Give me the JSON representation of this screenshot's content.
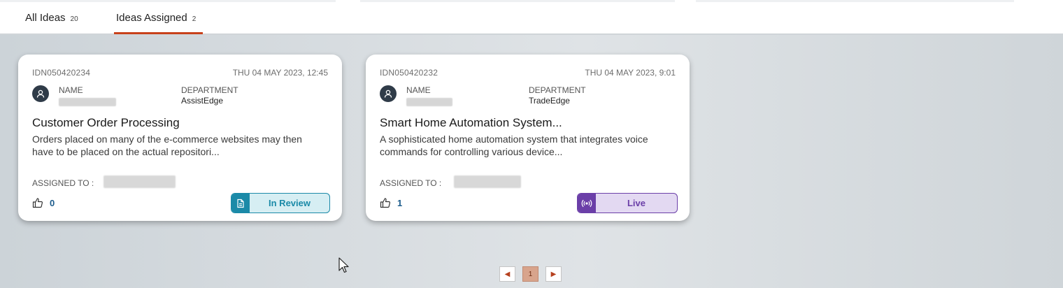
{
  "tabs": [
    {
      "label": "All Ideas",
      "count": "20"
    },
    {
      "label": "Ideas Assigned",
      "count": "2"
    }
  ],
  "labels": {
    "name": "NAME",
    "department": "DEPARTMENT",
    "assigned_to": "ASSIGNED TO :"
  },
  "cards": [
    {
      "id": "IDN050420234",
      "date": "THU 04 MAY 2023, 12:45",
      "department": "AssistEdge",
      "title": "Customer Order Processing",
      "description": "Orders placed on many of the e-commerce websites may then have to be placed on the actual repositori...",
      "likes": "0",
      "status": "In Review",
      "status_color": "#1b8aa8",
      "status_bg": "#d6eef3"
    },
    {
      "id": "IDN050420232",
      "date": "THU 04 MAY 2023, 9:01",
      "department": "TradeEdge",
      "title": "Smart Home Automation System...",
      "description": "A sophisticated home automation system that integrates voice commands for controlling various device...",
      "likes": "1",
      "status": "Live",
      "status_color": "#6b3fa8",
      "status_bg": "#e3d9f2"
    }
  ],
  "pagination": {
    "current": "1",
    "prev_icon": "caret-left-icon",
    "next_icon": "caret-right-icon"
  }
}
